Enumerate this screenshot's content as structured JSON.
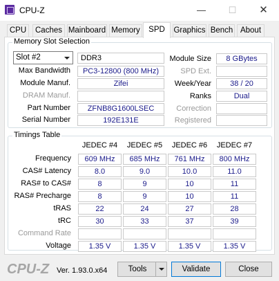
{
  "window": {
    "title": "CPU-Z",
    "minimize": "—",
    "maximize": "☐",
    "close": "✕"
  },
  "tabs": [
    "CPU",
    "Caches",
    "Mainboard",
    "Memory",
    "SPD",
    "Graphics",
    "Bench",
    "About"
  ],
  "active_tab": "SPD",
  "slot_section": {
    "title": "Memory Slot Selection",
    "slot_value": "Slot #2",
    "memory_type": "DDR3",
    "max_bandwidth_label": "Max Bandwidth",
    "max_bandwidth": "PC3-12800 (800 MHz)",
    "module_manuf_label": "Module Manuf.",
    "module_manuf": "Zifei",
    "dram_manuf_label": "DRAM Manuf.",
    "dram_manuf": "",
    "part_number_label": "Part Number",
    "part_number": "ZFNB8G1600LSEC",
    "serial_number_label": "Serial Number",
    "serial_number": "192E131E",
    "module_size_label": "Module Size",
    "module_size": "8 GBytes",
    "spd_ext_label": "SPD Ext.",
    "spd_ext": "",
    "week_year_label": "Week/Year",
    "week_year": "38 / 20",
    "ranks_label": "Ranks",
    "ranks": "Dual",
    "correction_label": "Correction",
    "correction": "",
    "registered_label": "Registered",
    "registered": ""
  },
  "timings": {
    "title": "Timings Table",
    "columns": [
      "JEDEC #4",
      "JEDEC #5",
      "JEDEC #6",
      "JEDEC #7"
    ],
    "rows": [
      {
        "label": "Frequency",
        "values": [
          "609 MHz",
          "685 MHz",
          "761 MHz",
          "800 MHz"
        ]
      },
      {
        "label": "CAS# Latency",
        "values": [
          "8.0",
          "9.0",
          "10.0",
          "11.0"
        ]
      },
      {
        "label": "RAS# to CAS#",
        "values": [
          "8",
          "9",
          "10",
          "11"
        ]
      },
      {
        "label": "RAS# Precharge",
        "values": [
          "8",
          "9",
          "10",
          "11"
        ]
      },
      {
        "label": "tRAS",
        "values": [
          "22",
          "24",
          "27",
          "28"
        ]
      },
      {
        "label": "tRC",
        "values": [
          "30",
          "33",
          "37",
          "39"
        ]
      },
      {
        "label": "Command Rate",
        "values": [
          "",
          "",
          "",
          ""
        ]
      },
      {
        "label": "Voltage",
        "values": [
          "1.35 V",
          "1.35 V",
          "1.35 V",
          "1.35 V"
        ]
      }
    ]
  },
  "footer": {
    "logo": "CPU-Z",
    "version": "Ver. 1.93.0.x64",
    "tools_label": "Tools",
    "validate_label": "Validate",
    "close_label": "Close"
  },
  "colors": {
    "value_text": "#1a1a8a",
    "disabled_text": "#9a9a9a",
    "accent": "#0078d7"
  }
}
